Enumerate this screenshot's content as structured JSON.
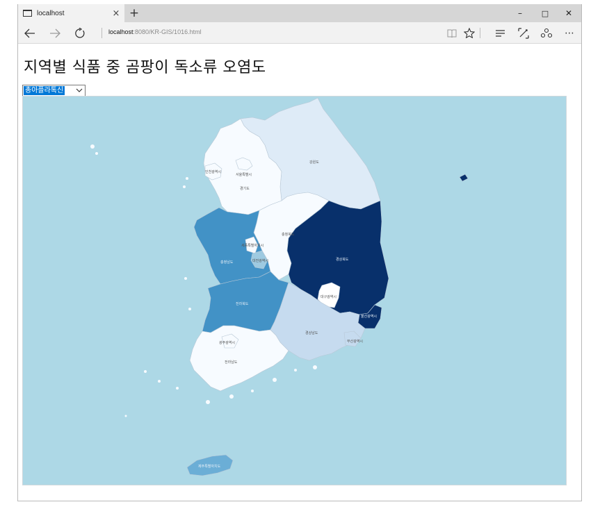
{
  "browser": {
    "tab_title": "localhost",
    "tab_close": "×",
    "new_tab": "+",
    "url_host": "localhost",
    "url_rest": ":8080/KR-GIS/1016.html",
    "icons": [
      "back-icon",
      "forward-icon",
      "refresh-icon",
      "reading-view-icon",
      "favorite-star-icon",
      "hub-icon",
      "web-note-icon",
      "share-icon",
      "more-icon"
    ],
    "window_controls": {
      "minimize": "–",
      "maximize": "□",
      "close": "✕"
    }
  },
  "page": {
    "title": "지역별 식품 중 곰팡이 독소류 오염도",
    "select": {
      "selected": "총아플라톡신"
    }
  },
  "map": {
    "background": "#add8e6",
    "regions": [
      {
        "id": "gangwon",
        "label": "강원도",
        "color": "#deebf7"
      },
      {
        "id": "gyeonggi",
        "label": "경기도",
        "color": "#f7fbff"
      },
      {
        "id": "seoul",
        "label": "서울특별시",
        "color": "#f7fbff"
      },
      {
        "id": "incheon",
        "label": "인천광역시",
        "color": "#f7fbff"
      },
      {
        "id": "chungbuk",
        "label": "충청북도",
        "color": "#f7fbff"
      },
      {
        "id": "chungnam",
        "label": "충청남도",
        "color": "#4292c6"
      },
      {
        "id": "sejong",
        "label": "세종특별자치시",
        "color": "#f7fbff"
      },
      {
        "id": "daejeon",
        "label": "대전광역시",
        "color": "#9ecae1"
      },
      {
        "id": "gyeongbuk",
        "label": "경상북도",
        "color": "#08306b"
      },
      {
        "id": "daegu",
        "label": "대구광역시",
        "color": "#ffffff"
      },
      {
        "id": "ulsan",
        "label": "울산광역시",
        "color": "#08306b"
      },
      {
        "id": "jeonbuk",
        "label": "전라북도",
        "color": "#4292c6"
      },
      {
        "id": "gyeongnam",
        "label": "경상남도",
        "color": "#c6dbef"
      },
      {
        "id": "busan",
        "label": "부산광역시",
        "color": "#c6dbef"
      },
      {
        "id": "gwangju",
        "label": "광주광역시",
        "color": "#f7fbff"
      },
      {
        "id": "jeonnam",
        "label": "전라남도",
        "color": "#f7fbff"
      },
      {
        "id": "jeju",
        "label": "제주특별자치도",
        "color": "#6baed6"
      }
    ]
  }
}
